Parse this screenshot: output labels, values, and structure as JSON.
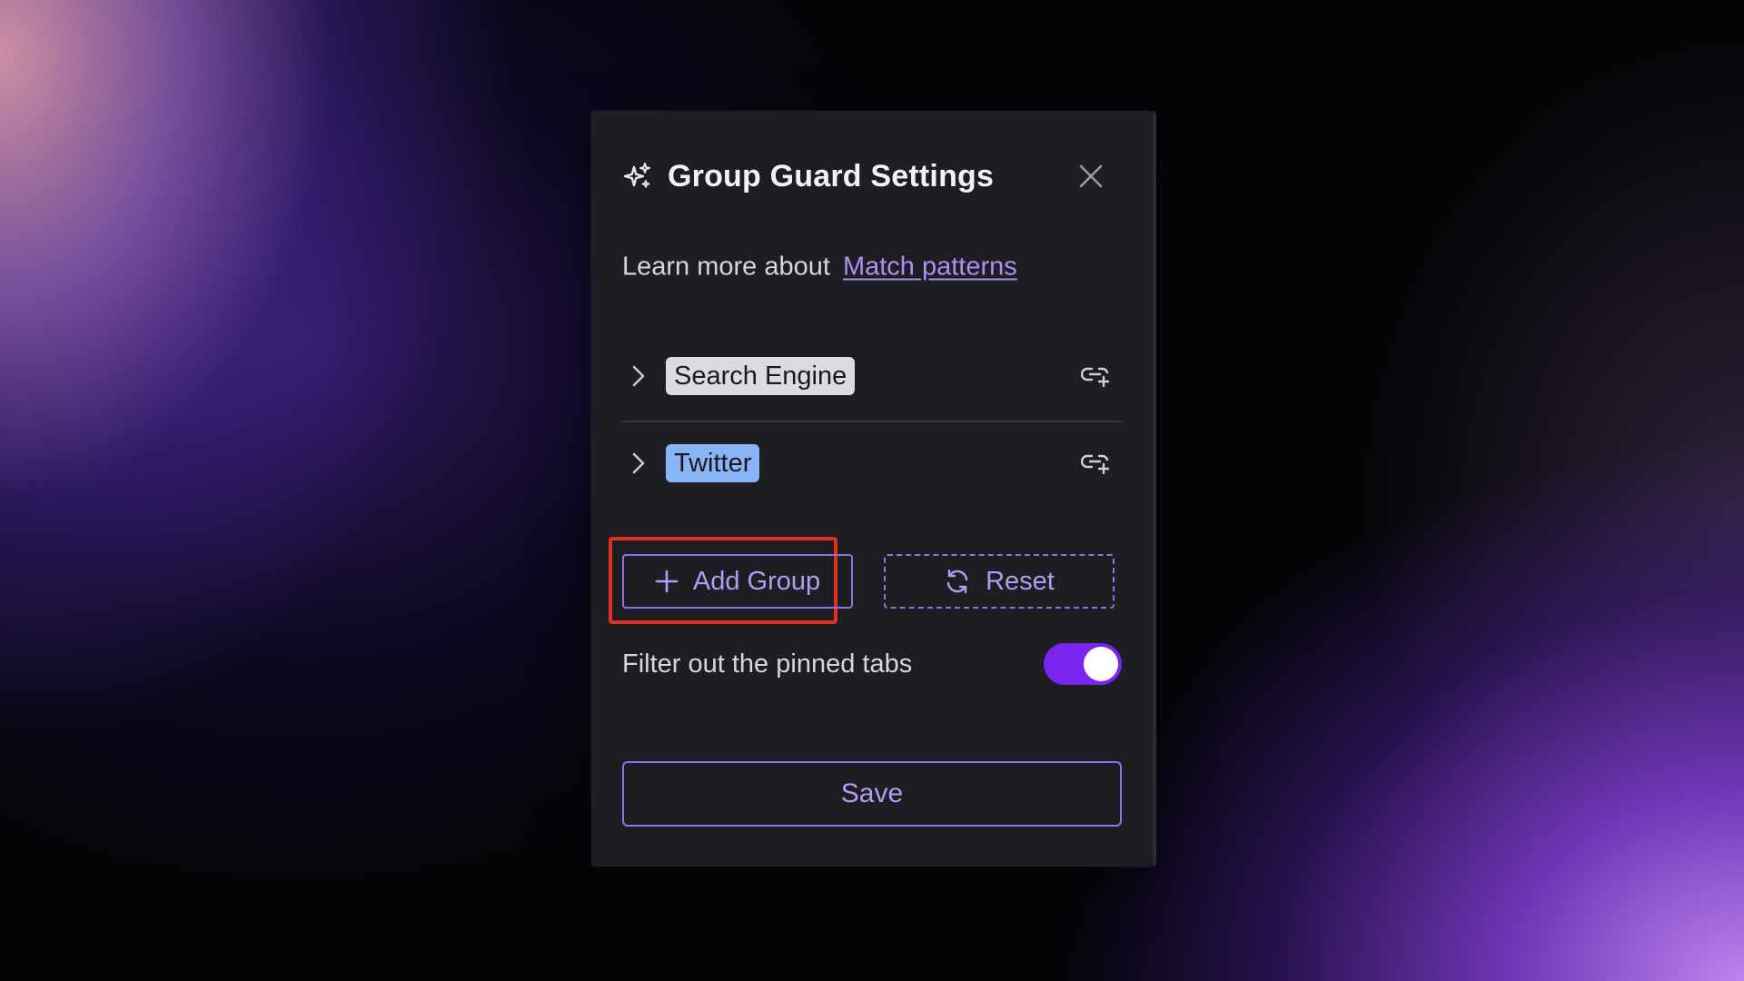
{
  "dialog": {
    "title": "Group Guard Settings",
    "icon": "sparkles-icon",
    "close_icon": "close-icon"
  },
  "learn_more": {
    "text": "Learn more about",
    "link_label": "Match patterns"
  },
  "groups": [
    {
      "name": "Search Engine",
      "color": "#dadce0",
      "expanded": false
    },
    {
      "name": "Twitter",
      "color": "#8ab4f8",
      "expanded": false
    }
  ],
  "actions": {
    "add_group_label": "Add Group",
    "reset_label": "Reset",
    "save_label": "Save"
  },
  "options": {
    "filter_pinned_label": "Filter out the pinned tabs",
    "filter_pinned_enabled": true
  },
  "colors": {
    "accent": "#8f72e6",
    "toggle_on": "#7a24f0",
    "highlight": "#e0301e",
    "link": "#b08cf5"
  }
}
